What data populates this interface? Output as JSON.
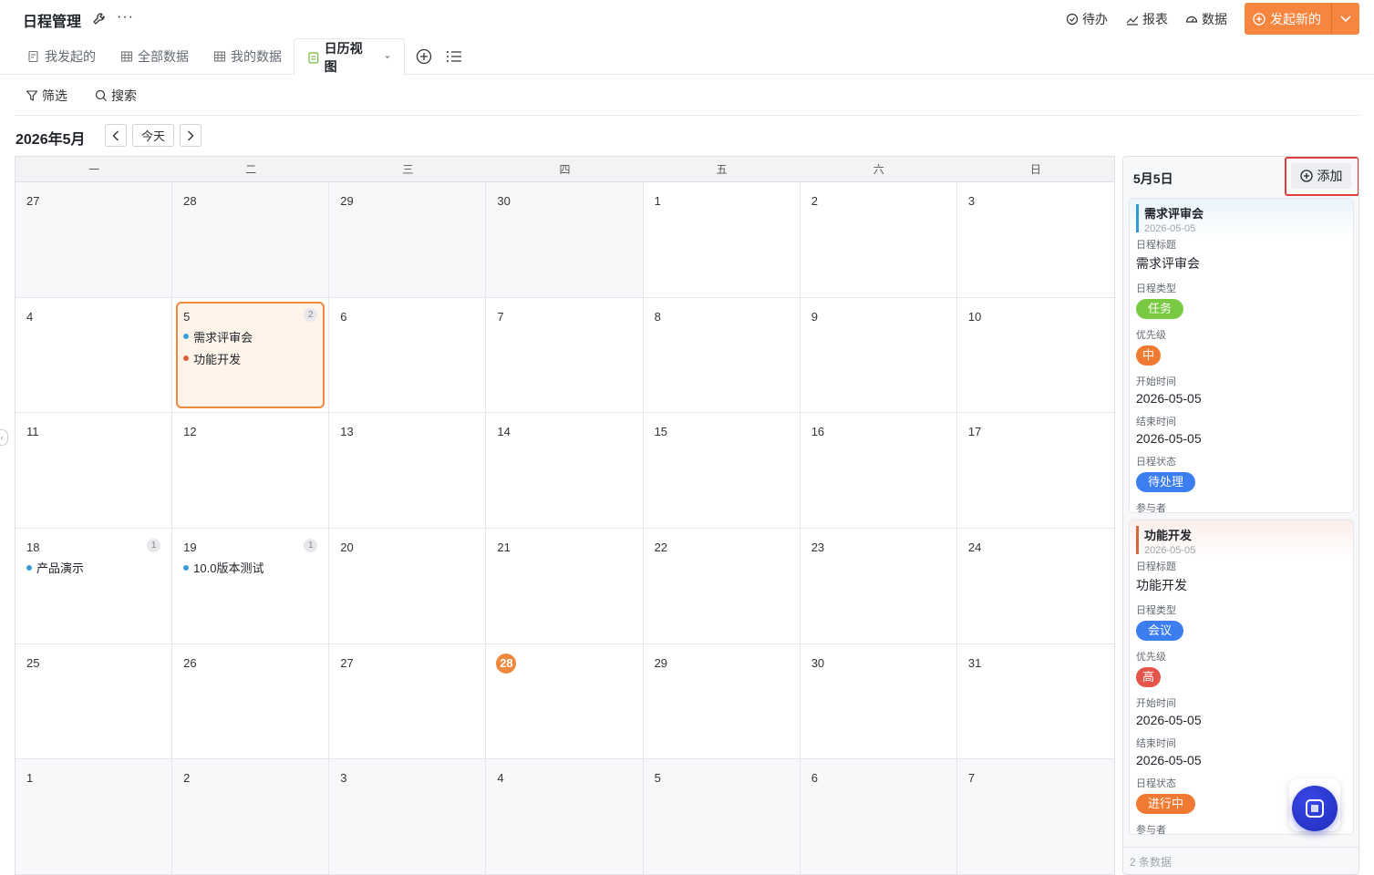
{
  "header": {
    "title": "日程管理",
    "more": "···",
    "links": {
      "todo": "待办",
      "report": "报表",
      "data": "数据"
    },
    "launch_label": "发起新的"
  },
  "tabs": {
    "mine_started": "我发起的",
    "all_data": "全部数据",
    "my_data": "我的数据",
    "calendar_view": "日历视图"
  },
  "filterbar": {
    "filter": "筛选",
    "search": "搜索"
  },
  "calendar": {
    "month_title": "2026年5月",
    "today_label": "今天",
    "weekdays": [
      "一",
      "二",
      "三",
      "四",
      "五",
      "六",
      "日"
    ],
    "weeks": [
      [
        {
          "n": "27",
          "muted": true
        },
        {
          "n": "28",
          "muted": true
        },
        {
          "n": "29",
          "muted": true
        },
        {
          "n": "30",
          "muted": true
        },
        {
          "n": "1"
        },
        {
          "n": "2"
        },
        {
          "n": "3"
        }
      ],
      [
        {
          "n": "4"
        },
        {
          "n": "5",
          "selected": true,
          "count": "2",
          "events": [
            {
              "title": "需求评审会",
              "color": "#3a9bd5"
            },
            {
              "title": "功能开发",
              "color": "#d9653b"
            }
          ]
        },
        {
          "n": "6"
        },
        {
          "n": "7"
        },
        {
          "n": "8"
        },
        {
          "n": "9"
        },
        {
          "n": "10"
        }
      ],
      [
        {
          "n": "11"
        },
        {
          "n": "12"
        },
        {
          "n": "13"
        },
        {
          "n": "14"
        },
        {
          "n": "15"
        },
        {
          "n": "16"
        },
        {
          "n": "17"
        }
      ],
      [
        {
          "n": "18",
          "count": "1",
          "events": [
            {
              "title": "产品演示",
              "color": "#3a9bd5"
            }
          ]
        },
        {
          "n": "19",
          "count": "1",
          "events": [
            {
              "title": "10.0版本测试",
              "color": "#3a9bd5"
            }
          ]
        },
        {
          "n": "20"
        },
        {
          "n": "21"
        },
        {
          "n": "22"
        },
        {
          "n": "23"
        },
        {
          "n": "24"
        }
      ],
      [
        {
          "n": "25"
        },
        {
          "n": "26"
        },
        {
          "n": "27"
        },
        {
          "n": "28",
          "today": true
        },
        {
          "n": "29"
        },
        {
          "n": "30"
        },
        {
          "n": "31"
        }
      ],
      [
        {
          "n": "1",
          "muted": true
        },
        {
          "n": "2",
          "muted": true
        },
        {
          "n": "3",
          "muted": true
        },
        {
          "n": "4",
          "muted": true
        },
        {
          "n": "5",
          "muted": true
        },
        {
          "n": "6",
          "muted": true
        },
        {
          "n": "7",
          "muted": true
        }
      ]
    ]
  },
  "panel": {
    "date": "5月5日",
    "add_label": "添加",
    "footer": "2 条数据",
    "cards": [
      {
        "title": "需求评审会",
        "date": "2026-05-05",
        "bar_color": "#2f9bd6",
        "head_bg": "linear-gradient(#eaf3fb, #ffffff)",
        "title_label": "日程标题",
        "title_value": "需求评审会",
        "type_label": "日程类型",
        "type_value": "任务",
        "type_color": "#7ac943",
        "priority_label": "优先级",
        "priority_value": "中",
        "priority_color": "#f07a32",
        "start_label": "开始时间",
        "start_value": "2026-05-05",
        "end_label": "结束时间",
        "end_value": "2026-05-05",
        "status_label": "日程状态",
        "status_value": "待处理",
        "status_color": "#3c7ef0",
        "participants_label": "参与者"
      },
      {
        "title": "功能开发",
        "date": "2026-05-05",
        "bar_color": "#d9653b",
        "head_bg": "linear-gradient(#fbeeea, #ffffff)",
        "title_label": "日程标题",
        "title_value": "功能开发",
        "type_label": "日程类型",
        "type_value": "会议",
        "type_color": "#3c7ef0",
        "priority_label": "优先级",
        "priority_value": "高",
        "priority_color": "#e5544b",
        "start_label": "开始时间",
        "start_value": "2026-05-05",
        "end_label": "结束时间",
        "end_value": "2026-05-05",
        "status_label": "日程状态",
        "status_value": "进行中",
        "status_color": "#f07a32",
        "participants_label": "参与者"
      }
    ]
  }
}
